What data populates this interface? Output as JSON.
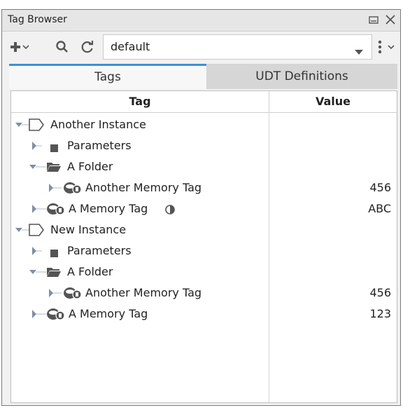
{
  "window": {
    "title": "Tag Browser"
  },
  "toolbar": {
    "provider_value": "default",
    "icons": [
      "add-icon",
      "search-icon",
      "refresh-icon",
      "kebab-menu-icon"
    ]
  },
  "tabs": [
    {
      "label": "Tags",
      "active": true
    },
    {
      "label": "UDT Definitions",
      "active": false
    }
  ],
  "table": {
    "columns": [
      "Tag",
      "Value"
    ],
    "rows": [
      {
        "label": "Another Instance",
        "value": "",
        "icon": "udt-instance-icon",
        "expanded": true,
        "level": 0
      },
      {
        "label": "Parameters",
        "value": "",
        "icon": "parameters-icon",
        "expanded": false,
        "level": 1
      },
      {
        "label": "A Folder",
        "value": "",
        "icon": "folder-icon",
        "expanded": true,
        "level": 1
      },
      {
        "label": "Another Memory Tag",
        "value": "456",
        "icon": "memory-tag-icon",
        "expanded": false,
        "level": 2
      },
      {
        "label": "A Memory Tag",
        "value": "ABC",
        "icon": "memory-tag-icon",
        "expanded": false,
        "level": 1,
        "badge": "override-badge-icon"
      },
      {
        "label": "New Instance",
        "value": "",
        "icon": "udt-instance-icon",
        "expanded": true,
        "level": 0
      },
      {
        "label": "Parameters",
        "value": "",
        "icon": "parameters-icon",
        "expanded": false,
        "level": 1
      },
      {
        "label": "A Folder",
        "value": "",
        "icon": "folder-icon",
        "expanded": true,
        "level": 1
      },
      {
        "label": "Another Memory Tag",
        "value": "456",
        "icon": "memory-tag-icon",
        "expanded": false,
        "level": 2
      },
      {
        "label": "A Memory Tag",
        "value": "123",
        "icon": "memory-tag-icon",
        "expanded": false,
        "level": 1
      }
    ]
  },
  "colors": {
    "accent": "#3f8fd7",
    "icon_gray": "#555555"
  }
}
